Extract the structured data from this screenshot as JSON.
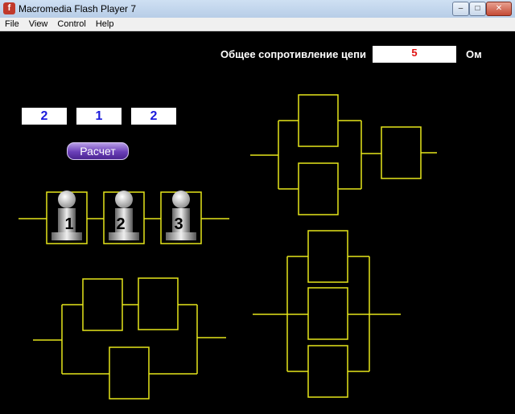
{
  "window": {
    "title": "Macromedia Flash Player 7",
    "buttons": {
      "minimize": "–",
      "maximize": "□",
      "close": "✕"
    }
  },
  "menubar": {
    "items": [
      "File",
      "View",
      "Control",
      "Help"
    ]
  },
  "total_resistance": {
    "label": "Общее сопротивление цепи",
    "value": "5",
    "unit": "Ом"
  },
  "inputs": {
    "values": [
      "2",
      "1",
      "2"
    ]
  },
  "calc_button": {
    "label": "Расчет"
  },
  "bulbs": {
    "labels": [
      "1",
      "2",
      "3"
    ]
  },
  "icons": {
    "app": "flash-player-icon",
    "bulb": "light-bulb-icon"
  },
  "colors": {
    "wire": "#e6e61a",
    "result_text": "#e01010",
    "input_text": "#1a1adc",
    "button": "#6a3fb8"
  }
}
